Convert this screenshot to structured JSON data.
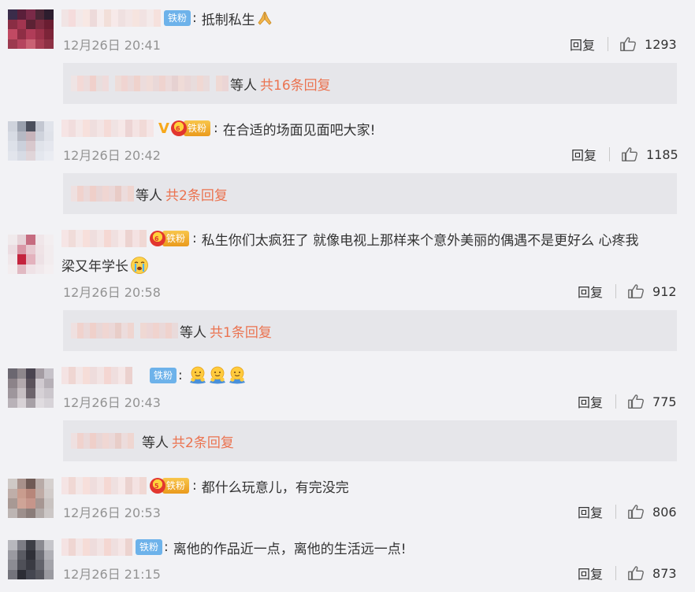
{
  "comments": [
    {
      "badge": "铁粉",
      "text": "抵制私生",
      "time": "12月26日 20:41",
      "reply_label": "回复",
      "likes": "1293",
      "thread": {
        "prefix": "等人",
        "total": "共16条回复"
      }
    },
    {
      "badge": "铁粉",
      "text": "在合适的场面见面吧大家!",
      "time": "12月26日 20:42",
      "reply_label": "回复",
      "likes": "1185",
      "thread": {
        "prefix": "等人",
        "total": "共2条回复"
      }
    },
    {
      "badge": "铁粉",
      "text": "私生你们太疯狂了 就像电视上那样来个意外美丽的偶遇不是更好么 心疼我",
      "text2": "梁又年学长",
      "time": "12月26日 20:58",
      "reply_label": "回复",
      "likes": "912",
      "thread": {
        "prefix": "等人",
        "total": "共1条回复"
      }
    },
    {
      "badge": "铁粉",
      "text": "",
      "time": "12月26日 20:43",
      "reply_label": "回复",
      "likes": "775",
      "thread": {
        "prefix": "等人",
        "total": "共2条回复"
      }
    },
    {
      "badge": "铁粉",
      "text": "都什么玩意儿，有完没完",
      "time": "12月26日 20:53",
      "reply_label": "回复",
      "likes": "806"
    },
    {
      "badge": "铁粉",
      "text": "离他的作品近一点，离他的生活远一点!",
      "time": "12月26日 21:15",
      "reply_label": "回复",
      "likes": "873"
    }
  ],
  "icons": {
    "like": "thumbs-up-icon",
    "verified": "vip-v-icon",
    "fan_crown": "fan-crown-icon",
    "emoji_pray": "pray-emoji-icon",
    "emoji_sad": "crying-emoji-icon",
    "emoji_hug": "hug-emoji-icon"
  },
  "colors": {
    "background": "#f2f2f5",
    "reply_box": "#e6e6ea",
    "reply_count": "#eb7350",
    "badge_blue": "#6db2ea",
    "badge_gold": "#ea9a1c",
    "meta_gray": "#939393"
  }
}
